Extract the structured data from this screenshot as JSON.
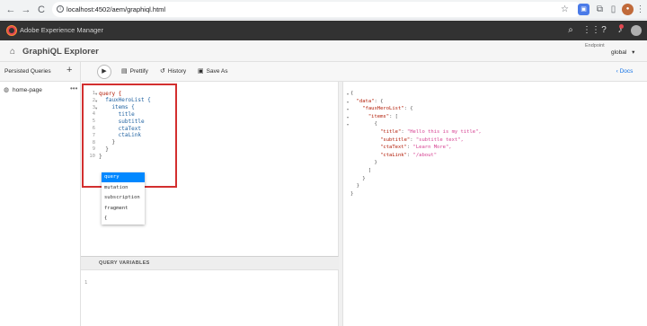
{
  "browser": {
    "back": "←",
    "forward": "→",
    "reload": "C",
    "home": "⌂",
    "url": "localhost:4502/aem/graphiql.html",
    "info_icon": "i",
    "icons": [
      "star-icon",
      "extension-icon",
      "puzzle-icon",
      "sidebar-icon",
      "profile-icon",
      "menu-icon"
    ]
  },
  "aem_header": {
    "product": "Adobe Experience Manager",
    "icons": [
      "search-icon",
      "apps-icon",
      "help-icon",
      "bell-icon",
      "user-icon"
    ]
  },
  "title_bar": {
    "title": "GraphiQL Explorer",
    "endpoint_label": "Endpoint",
    "endpoint_value": "global",
    "chevron": "▾"
  },
  "toolbar": {
    "persisted_queries": "Persisted Queries",
    "add": "+",
    "run": "▶",
    "prettify": "Prettify",
    "history": "History",
    "save_as": "Save As",
    "docs": "Docs"
  },
  "sidebar": {
    "items": [
      {
        "label": "home-page",
        "more": "•••"
      }
    ]
  },
  "editor": {
    "line_numbers": [
      "1",
      "2",
      "3",
      "4",
      "5",
      "6",
      "7",
      "8",
      "9",
      "10"
    ],
    "lines": [
      {
        "indent": "",
        "text": "query {",
        "kind": "kw"
      },
      {
        "indent": "  ",
        "text": "fauxHeroList {",
        "kind": "fld"
      },
      {
        "indent": "    ",
        "text": "items {",
        "kind": "fld"
      },
      {
        "indent": "      ",
        "text": "title",
        "kind": "fld"
      },
      {
        "indent": "      ",
        "text": "subtitle",
        "kind": "fld"
      },
      {
        "indent": "      ",
        "text": "ctaText",
        "kind": "fld"
      },
      {
        "indent": "      ",
        "text": "ctaLink",
        "kind": "fld"
      },
      {
        "indent": "    ",
        "text": "}",
        "kind": "pn"
      },
      {
        "indent": "  ",
        "text": "}",
        "kind": "pn"
      },
      {
        "indent": "",
        "text": "}",
        "kind": "pn"
      }
    ],
    "autocomplete": [
      "query",
      "mutation",
      "subscription",
      "fragment",
      "{"
    ]
  },
  "query_variables": {
    "label": "QUERY VARIABLES",
    "line": "1"
  },
  "result": {
    "lines": [
      {
        "indent": "",
        "key": "",
        "val": "{",
        "kind": "p"
      },
      {
        "indent": "  ",
        "key": "\"data\"",
        "val": ": {",
        "kind": "k"
      },
      {
        "indent": "    ",
        "key": "\"fauxHeroList\"",
        "val": ": {",
        "kind": "k"
      },
      {
        "indent": "      ",
        "key": "\"items\"",
        "val": ": [",
        "kind": "k"
      },
      {
        "indent": "        ",
        "key": "",
        "val": "{",
        "kind": "p"
      },
      {
        "indent": "          ",
        "key": "\"title\"",
        "val": "\"Hello this is my title\",",
        "kind": "kv"
      },
      {
        "indent": "          ",
        "key": "\"subtitle\"",
        "val": "\"subtitle text\",",
        "kind": "kv"
      },
      {
        "indent": "          ",
        "key": "\"ctaText\"",
        "val": "\"Learn More\",",
        "kind": "kv"
      },
      {
        "indent": "          ",
        "key": "\"ctaLink\"",
        "val": "\"/about\"",
        "kind": "kv"
      },
      {
        "indent": "        ",
        "key": "",
        "val": "}",
        "kind": "p"
      },
      {
        "indent": "      ",
        "key": "",
        "val": "]",
        "kind": "p"
      },
      {
        "indent": "    ",
        "key": "",
        "val": "}",
        "kind": "p"
      },
      {
        "indent": "  ",
        "key": "",
        "val": "}",
        "kind": "p"
      },
      {
        "indent": "",
        "key": "",
        "val": "}",
        "kind": "p"
      }
    ]
  },
  "colors": {
    "highlight_box": "#d32f2f",
    "autocomplete_selected": "#0088ff",
    "aem_header_bg": "#323232",
    "docs_link": "#1473e6"
  }
}
